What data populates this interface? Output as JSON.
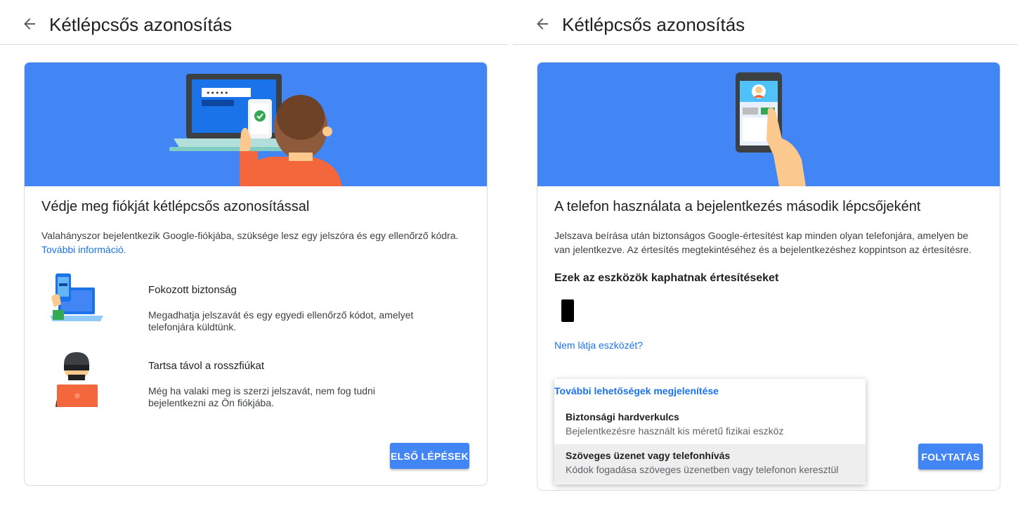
{
  "left": {
    "page_title": "Kétlépcsős azonosítás",
    "card_title": "Védje meg fiókját kétlépcsős azonosítással",
    "description": "Valahányszor bejelentkezik Google-fiókjába, szüksége lesz egy jelszóra és egy ellenőrző kódra.",
    "more_info_link": "További információ.",
    "hero_password_mask": "•••••",
    "features": [
      {
        "title": "Fokozott biztonság",
        "description": "Megadhatja jelszavát és egy egyedi ellenőrző kódot, amelyet telefonjára küldtünk.",
        "icon": "laptop-phone-icon"
      },
      {
        "title": "Tartsa távol a rosszfiúkat",
        "description": "Még ha valaki meg is szerzi jelszavát, nem fog tudni bejelentkezni az Ön fiókjába.",
        "icon": "hacker-icon"
      }
    ],
    "button_label": "ELSŐ LÉPÉSEK"
  },
  "right": {
    "page_title": "Kétlépcsős azonosítás",
    "card_title": "A telefon használata a bejelentkezés második lépcsőjeként",
    "description": "Jelszava beírása után biztonságos Google-értesítést kap minden olyan telefonjára, amelyen be van jelentkezve. Az értesítés megtekintéséhez és a bejelentkezéshez koppintson az értesítésre.",
    "devices_heading": "Ezek az eszközök kaphatnak értesítéseket",
    "device_icon": "smartphone-icon",
    "missing_device_link": "Nem látja eszközét?",
    "more_options_link": "További lehetőségek megjelenítése",
    "menu_items": [
      {
        "title": "Biztonsági hardverkulcs",
        "description": "Bejelentkezésre használt kis méretű fizikai eszköz"
      },
      {
        "title": "Szöveges üzenet vagy telefonhívás",
        "description": "Kódok fogadása szöveges üzenetben vagy telefonon keresztül",
        "selected": true
      }
    ],
    "button_label": "FOLYTATÁS"
  },
  "colors": {
    "accent": "#4285f4",
    "link": "#1a73e8",
    "hero_background": "#4285f4"
  }
}
